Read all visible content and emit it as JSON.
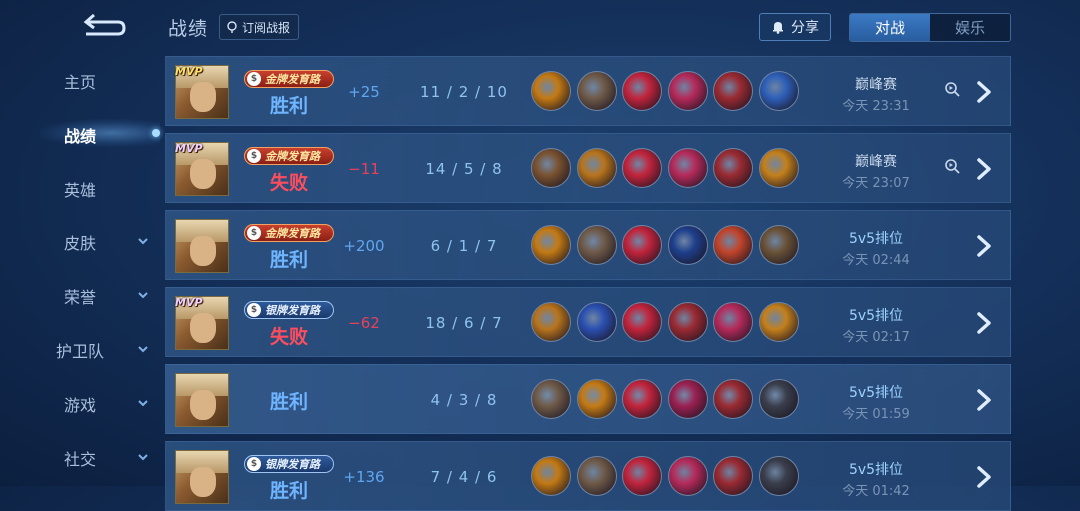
{
  "header": {
    "title": "战绩",
    "subscribe_label": "订阅战报",
    "share_label": "分享",
    "tabs": [
      {
        "label": "对战",
        "active": true
      },
      {
        "label": "娱乐",
        "active": false
      }
    ]
  },
  "sidebar": {
    "items": [
      {
        "label": "主页",
        "chevron": false,
        "active": false
      },
      {
        "label": "战绩",
        "chevron": false,
        "active": true
      },
      {
        "label": "英雄",
        "chevron": false,
        "active": false
      },
      {
        "label": "皮肤",
        "chevron": true,
        "active": false
      },
      {
        "label": "荣誉",
        "chevron": true,
        "active": false
      },
      {
        "label": "护卫队",
        "chevron": true,
        "active": false
      },
      {
        "label": "游戏",
        "chevron": true,
        "active": false
      },
      {
        "label": "社交",
        "chevron": true,
        "active": false
      }
    ]
  },
  "matches": [
    {
      "mvp": "MVP",
      "mvp_style": "gold",
      "badge": "金牌发育路",
      "badge_style": "gold",
      "result": "胜利",
      "result_type": "win",
      "points": "+25",
      "points_type": "pos",
      "kda": "11 / 2 / 10",
      "mode": "巅峰赛",
      "mode_type": "peak",
      "time": "今天 23:31",
      "replay": true,
      "items": [
        "#c47a14",
        "#6f5a48",
        "#c2243c",
        "#b52a5a",
        "#9a2a32",
        "#2d5fb8"
      ]
    },
    {
      "mvp": "MVP",
      "mvp_style": "silver",
      "badge": "金牌发育路",
      "badge_style": "gold",
      "result": "失败",
      "result_type": "lose",
      "points": "−11",
      "points_type": "neg",
      "kda": "14 / 5 / 8",
      "mode": "巅峰赛",
      "mode_type": "peak",
      "time": "今天 23:07",
      "replay": true,
      "items": [
        "#7a5230",
        "#b8741c",
        "#c2243c",
        "#b52a5a",
        "#9a2a32",
        "#c4801c"
      ]
    },
    {
      "mvp": "",
      "mvp_style": "gold",
      "badge": "金牌发育路",
      "badge_style": "gold",
      "result": "胜利",
      "result_type": "win",
      "points": "+200",
      "points_type": "pos",
      "kda": "6 / 1 / 7",
      "mode": "5v5排位",
      "mode_type": "rank",
      "time": "今天 02:44",
      "replay": false,
      "items": [
        "#c47a14",
        "#6f5a48",
        "#c2243c",
        "#1e3f8c",
        "#c2442a",
        "#6a5238"
      ]
    },
    {
      "mvp": "MVP",
      "mvp_style": "silver",
      "badge": "银牌发育路",
      "badge_style": "silver",
      "result": "失败",
      "result_type": "lose",
      "points": "−62",
      "points_type": "neg",
      "kda": "18 / 6 / 7",
      "mode": "5v5排位",
      "mode_type": "rank",
      "time": "今天 02:17",
      "replay": false,
      "items": [
        "#b8741c",
        "#2a4fb0",
        "#c2243c",
        "#9a2a32",
        "#b52a5a",
        "#c4801c"
      ]
    },
    {
      "mvp": "",
      "mvp_style": "gold",
      "badge": "",
      "badge_style": "",
      "result": "胜利",
      "result_type": "win",
      "points": "",
      "points_type": "pos",
      "kda": "4 / 3 / 8",
      "mode": "5v5排位",
      "mode_type": "rank",
      "time": "今天 01:59",
      "replay": false,
      "items": [
        "#6f5a48",
        "#c47a14",
        "#c2243c",
        "#9a2050",
        "#9a2a32",
        "#3a3e4c"
      ]
    },
    {
      "mvp": "",
      "mvp_style": "gold",
      "badge": "银牌发育路",
      "badge_style": "silver",
      "result": "胜利",
      "result_type": "win",
      "points": "+136",
      "points_type": "pos",
      "kda": "7 / 4 / 6",
      "mode": "5v5排位",
      "mode_type": "rank",
      "time": "今天 01:42",
      "replay": false,
      "items": [
        "#c47a14",
        "#6f5a48",
        "#c2243c",
        "#b52a5a",
        "#9a2a32",
        "#3a3e4c"
      ]
    }
  ]
}
